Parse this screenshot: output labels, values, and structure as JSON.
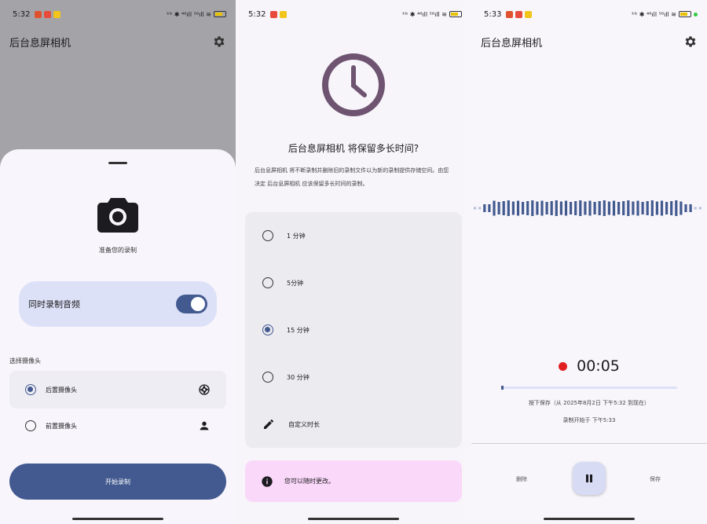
{
  "colors": {
    "accent": "#435a90",
    "sheet_bg": "#f8f6fc",
    "scrim": "#a3a3a8",
    "info_bg": "#fad8f9",
    "record_red": "#e02020"
  },
  "screen1": {
    "status": {
      "time": "5:32",
      "right": "ᵏᵇ ✱ ⁴⁶ıll ⁵⁶ıll ≋"
    },
    "appbar": {
      "title": "后台息屏相机",
      "settings_icon": "gear-icon"
    },
    "prepare_text": "准备您的录制",
    "audio_toggle": {
      "label": "同时录制音频",
      "on": true
    },
    "camera_section_label": "选择摄像头",
    "cameras": [
      {
        "label": "后置摄像头",
        "selected": true,
        "icon": "aperture-icon"
      },
      {
        "label": "前置摄像头",
        "selected": false,
        "icon": "person-icon"
      }
    ],
    "start_button": "开始录制"
  },
  "screen2": {
    "status": {
      "time": "5:32",
      "right": "ᵏᵇ ✱ ⁴⁶ıll ⁵⁶ıll ≋"
    },
    "question": "后台息屏相机 将保留多长时间?",
    "description": "后台息屏相机 将不断录制并删除旧的录制文件以为新的录制提供存储空间。由您决定 后台息屏相机 应该保留多长时间的录制。",
    "options": [
      {
        "label": "1 分钟",
        "selected": false
      },
      {
        "label": "5分钟",
        "selected": false
      },
      {
        "label": "15 分钟",
        "selected": true
      },
      {
        "label": "30 分钟",
        "selected": false
      }
    ],
    "custom_option": "自定义时长",
    "info_text": "您可以随时更改。"
  },
  "screen3": {
    "status": {
      "time": "5:33",
      "right": "ᵏᵇ ✱ ⁴⁶ıll ⁵⁶ıll ≋"
    },
    "appbar": {
      "title": "后台息屏相机",
      "settings_icon": "gear-icon"
    },
    "timer": "00:05",
    "progress": 0.01,
    "save_hint": "按下保存（从 2025年8月2日 下午5:32 到现在）",
    "started_at": "录制开始于 下午5:33",
    "delete_label": "删除",
    "save_label": "保存"
  }
}
